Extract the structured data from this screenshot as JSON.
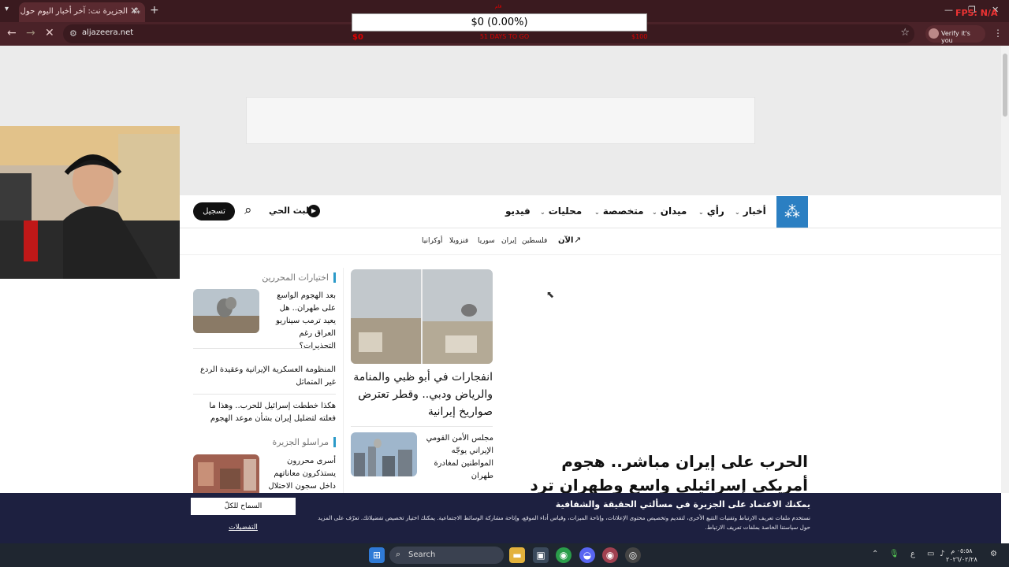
{
  "browser": {
    "tab_title": "الجزيرة نت: آخر أخبار اليوم حول ال...",
    "tab_close": "×",
    "new_tab": "+",
    "url": "aljazeera.net",
    "profile_label": "Verify it's you"
  },
  "overlay": {
    "donation_amount": "$0 (0.00%)",
    "donation_days": "51 DAYS TO GO",
    "donation_min": "$0",
    "donation_max": "$100",
    "donation_top": "قام",
    "fps": "FPS: N/A"
  },
  "nav": {
    "items": [
      "أخبار",
      "رأي",
      "ميدان",
      "متخصصة",
      "محليات",
      "فيديو"
    ],
    "live": "البث الحي",
    "signup": "تسجيل"
  },
  "trending": {
    "now": "الآن",
    "items": [
      "فلسطين",
      "إيران",
      "سوريا",
      "فنزويلا",
      "أوكرانيا"
    ]
  },
  "sidebar": {
    "editors_title": "اختيارات المحررين",
    "editors_items": [
      "بعد الهجوم الواسع على طهران.. هل يعيد ترمب سيناريو العراق رغم التحذيرات؟",
      "المنظومة العسكرية الإيرانية وعقيدة الردع غير المتماثل",
      "هكذا خططت إسرائيل للحرب.. وهذا ما فعلته لتضليل إيران بشأن موعد الهجوم"
    ],
    "correspondents_title": "مراسلو الجزيرة",
    "correspondents_item": "أسرى محررون يستذكرون معاناتهم داخل سجون الاحتلال"
  },
  "main": {
    "mid_headline": "انفجارات في أبو ظبي والمنامة والرياض ودبي.. وقطر تعترض صواريخ إيرانية",
    "mid_sub": "مجلس الأمن القومي الإيراني يوجّه المواطنين لمغادرة طهران",
    "big_headline": "الحرب على إيران مباشر.. هجوم أمريكي إسرائيلي واسع وطهران ترد"
  },
  "cookie": {
    "title": "يمكنك الاعتماد على الجزيرة في مسألتي الحقيقة والشفافية",
    "body": "نستخدم ملفات تعريف الارتباط وتقنيات التتبع الأخرى، لتقديم وتخصيص محتوى الإعلانات، وإتاحة الميزات، وقياس أداء الموقع، وإتاحة مشاركة الوسائط الاجتماعية. يمكنك اختيار تخصيص تفضيلاتك. تعرّف على المزيد حول سياستنا الخاصة بملفات تعريف الارتباط.",
    "allow_all": "السماح للكلّ",
    "preferences": "التفضيلات"
  },
  "taskbar": {
    "search": "Search",
    "lang": "ع",
    "time": "٠٥:٥٨ م",
    "date": "٢٠٢٦/٠٢/٢٨"
  },
  "colors": {
    "accent": "#2b9ac8",
    "logo_bg": "#2b7fc2",
    "cookie_bg": "#1d2040"
  }
}
